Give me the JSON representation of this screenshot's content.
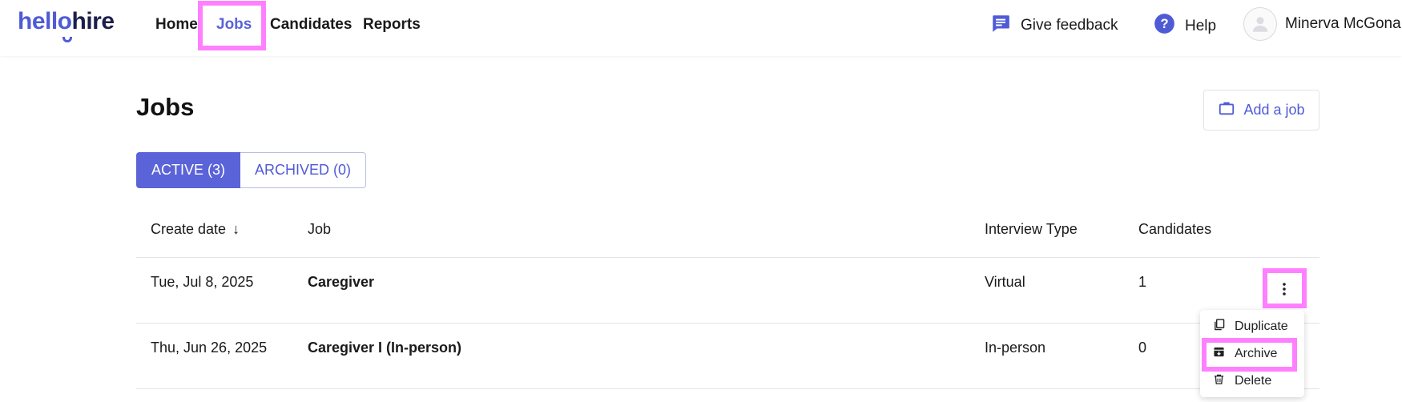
{
  "app": {
    "logo_part1": "hello",
    "logo_part2": "hire"
  },
  "nav": {
    "items": [
      {
        "label": "Home"
      },
      {
        "label": "Jobs"
      },
      {
        "label": "Candidates"
      },
      {
        "label": "Reports"
      }
    ],
    "active": "Jobs"
  },
  "header": {
    "feedback_label": "Give feedback",
    "help_label": "Help",
    "user_name": "Minerva McGona..."
  },
  "page": {
    "title": "Jobs",
    "add_job_label": "Add a job"
  },
  "tabs": [
    {
      "label": "ACTIVE (3)",
      "active": true
    },
    {
      "label": "ARCHIVED (0)",
      "active": false
    }
  ],
  "table": {
    "columns": [
      "Create date",
      "Job",
      "Interview Type",
      "Candidates"
    ],
    "sort_indicator": "↓",
    "rows": [
      {
        "date": "Tue, Jul 8, 2025",
        "job": "Caregiver",
        "type": "Virtual",
        "candidates": "1"
      },
      {
        "date": "Thu, Jun 26, 2025",
        "job": "Caregiver I (In-person)",
        "type": "In-person",
        "candidates": "0"
      }
    ]
  },
  "row_menu": {
    "items": [
      {
        "label": "Duplicate",
        "icon": "duplicate-icon"
      },
      {
        "label": "Archive",
        "icon": "archive-icon"
      },
      {
        "label": "Delete",
        "icon": "trash-icon"
      }
    ]
  },
  "colors": {
    "brand": "#4f5bd5",
    "brand_dark": "#1c1f4a",
    "highlight": "#ff80ff"
  }
}
